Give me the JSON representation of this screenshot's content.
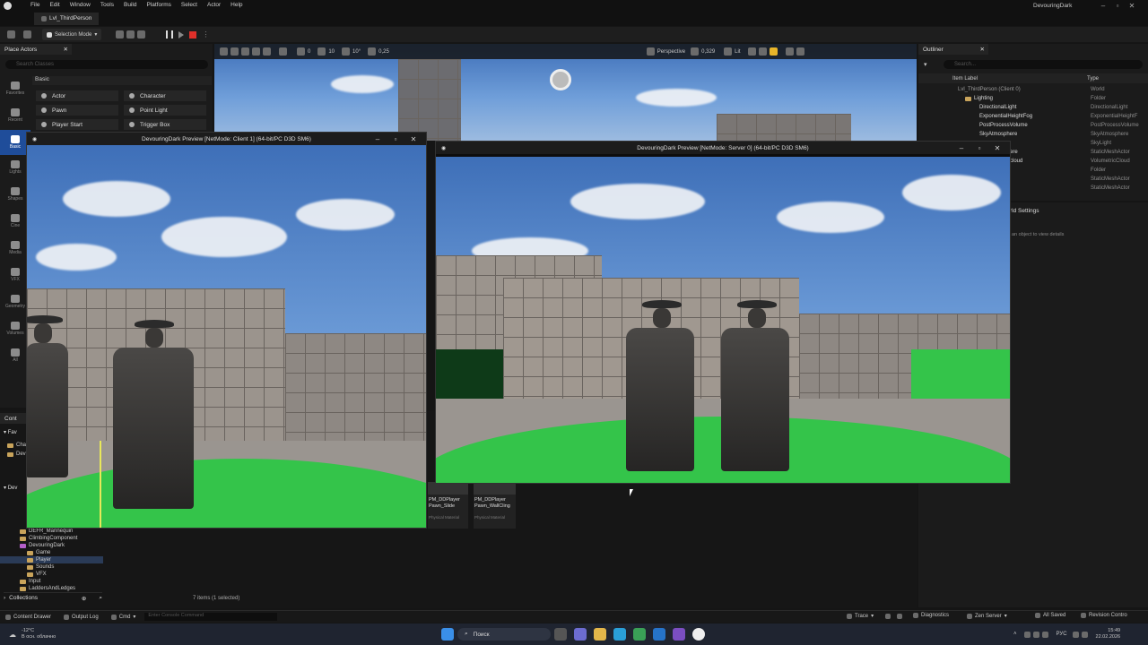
{
  "titlebar": {
    "menu": [
      "File",
      "Edit",
      "Window",
      "Tools",
      "Build",
      "Platforms",
      "Select",
      "Actor",
      "Help"
    ],
    "project": "DevouringDark",
    "level_tab": "Lvl_ThirdPerson"
  },
  "toolbar": {
    "selection_mode": "Selection Mode"
  },
  "viewport_toolbar": {
    "perspective": "Perspective",
    "fov": "0,329",
    "lit": "Lit",
    "snap_move": "10",
    "snap_rot": "10°",
    "snap_scale": "0,25",
    "cam_value": "0"
  },
  "place_actors": {
    "tab": "Place Actors",
    "search_placeholder": "Search Classes",
    "section": "Basic",
    "categories": [
      "Favorites",
      "Recent",
      "Basic",
      "Lights",
      "Shapes",
      "Cine",
      "Media",
      "VFX",
      "Geometry",
      "Volumes",
      "All"
    ],
    "items_left": [
      "Actor",
      "Pawn",
      "Player Start"
    ],
    "items_right": [
      "Character",
      "Point Light",
      "Trigger Box"
    ]
  },
  "client_window": {
    "title": "DevouringDark Preview [NetMode: Client 1]  (64-bit/PC D3D SM6)"
  },
  "server_window": {
    "title": "DevouringDark Preview [NetMode: Server 0]  (64-bit/PC D3D SM6)"
  },
  "outliner": {
    "tab": "Outliner",
    "search_placeholder": "Search...",
    "col_label": "Item Label",
    "col_type": "Type",
    "rows": [
      {
        "label": "Lvl_ThirdPerson (Client 0)",
        "type": "World",
        "indent": 1
      },
      {
        "label": "Lighting",
        "type": "Folder",
        "indent": 2
      },
      {
        "label": "DirectionalLight",
        "type": "DirectionalLight",
        "indent": 3
      },
      {
        "label": "ExponentialHeightFog",
        "type": "ExponentialHeightF",
        "indent": 3
      },
      {
        "label": "PostProcessVolume",
        "type": "PostProcessVolume",
        "indent": 3
      },
      {
        "label": "SkyAtmosphere",
        "type": "SkyAtmosphere",
        "indent": 3
      },
      {
        "label": "",
        "type": "SkyLight",
        "indent": 3
      },
      {
        "label": "ere",
        "type": "StaticMeshActor",
        "indent": 3
      },
      {
        "label": "cloud",
        "type": "VolumetricCloud",
        "indent": 3
      },
      {
        "label": "",
        "type": "Folder",
        "indent": 3
      },
      {
        "label": "",
        "type": "StaticMeshActor",
        "indent": 3
      },
      {
        "label": "",
        "type": "StaticMeshActor",
        "indent": 3
      }
    ],
    "details_tab": "rld Settings",
    "details_hint": "an object to view details"
  },
  "content_browser": {
    "tab": "Cont",
    "favorites": "Fav",
    "fav_items": [
      "Cha",
      "Dev"
    ],
    "dev_header": "Dev",
    "tree": [
      "DEFR_Mannequin",
      "ClimbingComponent",
      "DevouringDark",
      "Game",
      "Player",
      "Sounds",
      "VFX",
      "Input",
      "LaddersAndLedges"
    ],
    "collections": "Collections",
    "assets": [
      {
        "name": "PM_DDPlayer Pawn_Slide",
        "type": "Physical Material"
      },
      {
        "name": "PM_DDPlayer Pawn_WallCling",
        "type": "Physical Material"
      }
    ],
    "items_count": "7 items (1 selected)"
  },
  "statusbar": {
    "content_drawer": "Content Drawer",
    "output_log": "Output Log",
    "cmd": "Cmd",
    "console_placeholder": "Enter Console Command",
    "trace": "Trace",
    "diagnostics": "Diagnostics",
    "zen": "Zen Server",
    "saved": "All Saved",
    "revision": "Revision Contro"
  },
  "taskbar": {
    "weather_temp": "-12°C",
    "weather_desc": "В осн. облачно",
    "search": "Поиск",
    "lang": "РУС",
    "time": "15:49",
    "date": "22.02.2026"
  },
  "colors": {
    "accent": "#1f4d9a",
    "green": "#34c44a",
    "record": "#e0302a"
  }
}
